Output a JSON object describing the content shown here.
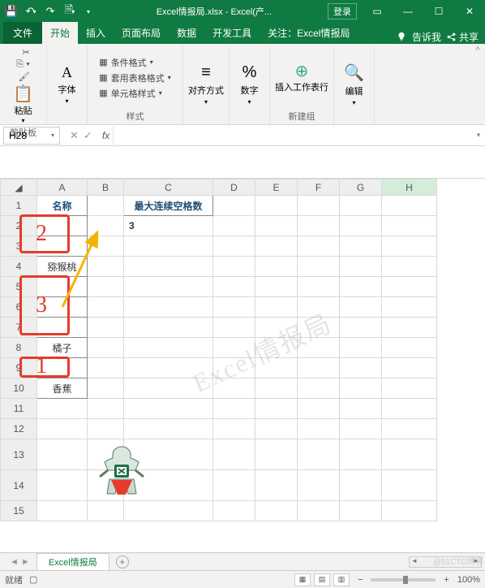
{
  "titlebar": {
    "filename": "Excel情报局.xlsx",
    "app": "Excel(产...",
    "login": "登录"
  },
  "tabs": {
    "file": "文件",
    "home": "开始",
    "insert": "插入",
    "layout": "页面布局",
    "data": "数据",
    "dev": "开发工具",
    "attn": "关注：Excel情报局",
    "tellme": "告诉我",
    "share": "共享"
  },
  "ribbon": {
    "clipboard": {
      "paste": "粘贴",
      "label": "剪贴板"
    },
    "font": {
      "btn": "字体",
      "label": ""
    },
    "styles": {
      "cond": "条件格式",
      "tbl": "套用表格格式",
      "cell": "单元格样式",
      "label": "样式"
    },
    "align": {
      "btn": "对齐方式",
      "label": ""
    },
    "number": {
      "btn": "数字",
      "label": ""
    },
    "insert": {
      "ins": "插入工作表行",
      "grp": "新建组"
    },
    "edit": {
      "btn": "编辑",
      "label": ""
    }
  },
  "namebox": "H28",
  "columns": {
    "A": "A",
    "B": "B",
    "C": "C",
    "D": "D",
    "E": "E",
    "F": "F",
    "G": "G",
    "H": "H"
  },
  "rows": [
    "1",
    "2",
    "3",
    "4",
    "5",
    "6",
    "7",
    "8",
    "9",
    "10",
    "11",
    "12",
    "13",
    "14",
    "15"
  ],
  "cells": {
    "A1": "名称",
    "C1": "最大连续空格数",
    "C2": "3",
    "A4": "猕猴桃",
    "A8": "橘子",
    "A10": "香蕉"
  },
  "annotations": {
    "n1": "1",
    "n2": "2",
    "n3": "3"
  },
  "watermark": "Excel情报局",
  "sheet_tab": "Excel情报局",
  "status": {
    "ready": "就绪",
    "zoom": "100%"
  },
  "copyright": "@51CTO博客"
}
